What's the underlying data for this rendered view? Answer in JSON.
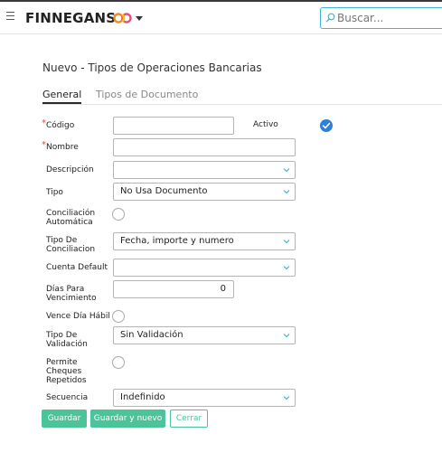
{
  "header": {
    "brand": "FINNEGANS",
    "search_placeholder": "Buscar..."
  },
  "page": {
    "title": "Nuevo - Tipos de Operaciones Bancarias"
  },
  "tabs": [
    {
      "label": "General",
      "active": true
    },
    {
      "label": "Tipos de Documento",
      "active": false
    }
  ],
  "form": {
    "codigo": {
      "label": "Código",
      "required": true,
      "value": ""
    },
    "activo": {
      "label": "Activo",
      "checked": true
    },
    "nombre": {
      "label": "Nombre",
      "required": true,
      "value": ""
    },
    "descripcion": {
      "label": "Descripción",
      "value": ""
    },
    "tipo": {
      "label": "Tipo",
      "value": "No Usa Documento"
    },
    "conciliacion_automatica": {
      "label_line1": "Conciliación",
      "label_line2": "Automática",
      "checked": false
    },
    "tipo_conciliacion": {
      "label_line1": "Tipo De",
      "label_line2": "Conciliacion",
      "value": "Fecha, importe y numero"
    },
    "cuenta_default": {
      "label": "Cuenta Default",
      "value": ""
    },
    "dias_vencimiento": {
      "label_line1": "Días Para",
      "label_line2": "Vencimiento",
      "value": "0"
    },
    "vence_dia_habil": {
      "label": "Vence Día Hábil",
      "checked": false
    },
    "tipo_validacion": {
      "label_line1": "Tipo De",
      "label_line2": "Validación",
      "value": "Sin Validación"
    },
    "permite_cheques": {
      "label_line1": "Permite",
      "label_line2": "Cheques",
      "label_line3": "Repetidos",
      "checked": false
    },
    "secuencia": {
      "label": "Secuencia",
      "value": "Indefinido"
    }
  },
  "actions": {
    "save": "Guardar",
    "save_new": "Guardar y nuevo",
    "close": "Cerrar"
  },
  "colors": {
    "accent": "#4cc49a",
    "search_border": "#3fb6d8",
    "check": "#2e7fd6",
    "required": "#d9534f"
  }
}
